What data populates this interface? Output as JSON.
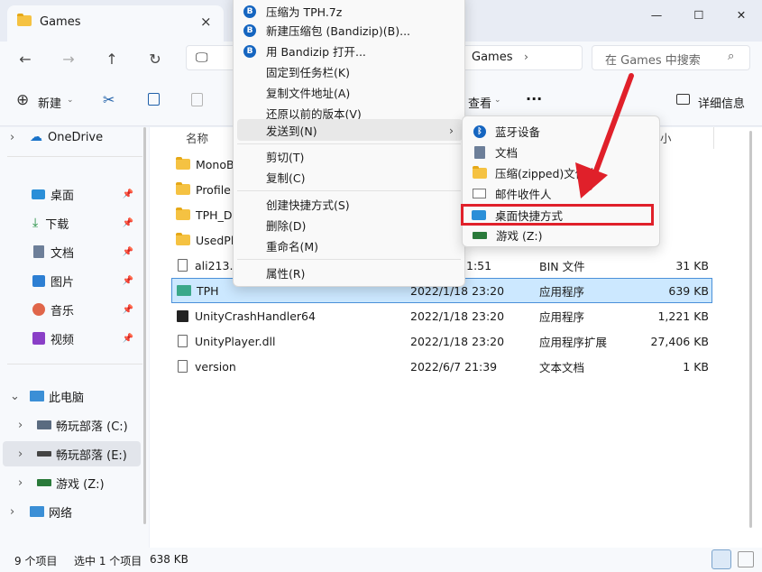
{
  "window": {
    "tab_title": "Games",
    "minimize": "—",
    "maximize": "☐",
    "close": "✕"
  },
  "nav": {
    "breadcrumb_current": "Games",
    "search_placeholder": "在 Games 中搜索"
  },
  "toolbar": {
    "new_label": "新建",
    "view_label": "查看",
    "more_label": "···",
    "details_label": "详细信息"
  },
  "sidebar": {
    "onedrive": "OneDrive",
    "quick": [
      {
        "label": "桌面",
        "icon": "desktop-icon"
      },
      {
        "label": "下载",
        "icon": "download-icon"
      },
      {
        "label": "文档",
        "icon": "document-icon"
      },
      {
        "label": "图片",
        "icon": "picture-icon"
      },
      {
        "label": "音乐",
        "icon": "music-icon"
      },
      {
        "label": "视频",
        "icon": "video-icon"
      }
    ],
    "this_pc": "此电脑",
    "drives": [
      {
        "label": "畅玩部落 (C:)"
      },
      {
        "label": "畅玩部落 (E:)"
      },
      {
        "label": "游戏 (Z:)"
      }
    ],
    "network": "网络"
  },
  "table": {
    "col_name": "名称",
    "col_size": "小",
    "rows": [
      {
        "name": "MonoB",
        "date": "",
        "type": "",
        "size": ""
      },
      {
        "name": "Profile",
        "date": "",
        "type": "",
        "size": ""
      },
      {
        "name": "TPH_Da",
        "date": "",
        "type": "",
        "size": ""
      },
      {
        "name": "UsedPlu",
        "date": "",
        "type": "",
        "size": ""
      },
      {
        "name": "ali213.b",
        "date": "1:51",
        "type": "BIN 文件",
        "size": "31 KB"
      },
      {
        "name": "TPH",
        "date": "2022/1/18 23:20",
        "type": "应用程序",
        "size": "639 KB"
      },
      {
        "name": "UnityCrashHandler64",
        "date": "2022/1/18 23:20",
        "type": "应用程序",
        "size": "1,221 KB"
      },
      {
        "name": "UnityPlayer.dll",
        "date": "2022/1/18 23:20",
        "type": "应用程序扩展",
        "size": "27,406 KB"
      },
      {
        "name": "version",
        "date": "2022/6/7 21:39",
        "type": "文本文档",
        "size": "1 KB"
      }
    ]
  },
  "context_menu": {
    "items": [
      {
        "label": "压缩为 TPH.7z"
      },
      {
        "label": "新建压缩包 (Bandizip)(B)..."
      },
      {
        "label": "用 Bandizip 打开..."
      },
      {
        "label": "固定到任务栏(K)"
      },
      {
        "label": "复制文件地址(A)"
      },
      {
        "label": "还原以前的版本(V)"
      },
      {
        "label": "发送到(N)"
      },
      {
        "label": "剪切(T)"
      },
      {
        "label": "复制(C)"
      },
      {
        "label": "创建快捷方式(S)"
      },
      {
        "label": "删除(D)"
      },
      {
        "label": "重命名(M)"
      },
      {
        "label": "属性(R)"
      }
    ]
  },
  "submenu": {
    "items": [
      {
        "label": "蓝牙设备"
      },
      {
        "label": "文档"
      },
      {
        "label": "压缩(zipped)文件夹"
      },
      {
        "label": "邮件收件人"
      },
      {
        "label": "桌面快捷方式"
      },
      {
        "label": "游戏 (Z:)"
      }
    ]
  },
  "status": {
    "count": "9 个项目",
    "selected": "选中 1 个项目",
    "size": "638 KB"
  },
  "colors": {
    "highlight_red": "#e0202a",
    "selection": "#cce8ff",
    "accent": "#0067c0"
  }
}
